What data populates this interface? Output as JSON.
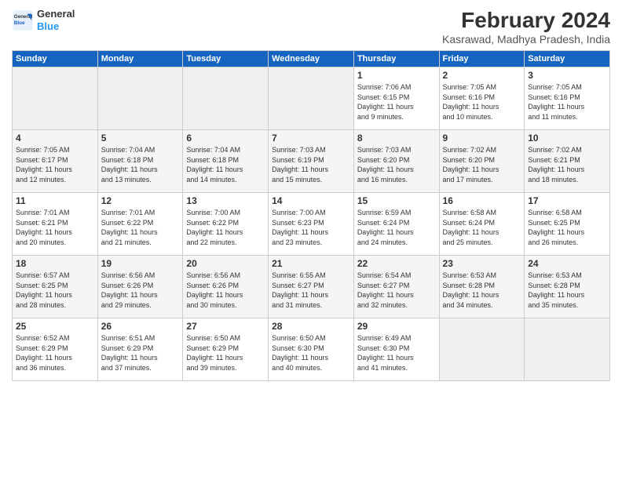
{
  "logo": {
    "line1": "General",
    "line2": "Blue"
  },
  "title": "February 2024",
  "subtitle": "Kasrawad, Madhya Pradesh, India",
  "headers": [
    "Sunday",
    "Monday",
    "Tuesday",
    "Wednesday",
    "Thursday",
    "Friday",
    "Saturday"
  ],
  "weeks": [
    [
      {
        "day": "",
        "info": ""
      },
      {
        "day": "",
        "info": ""
      },
      {
        "day": "",
        "info": ""
      },
      {
        "day": "",
        "info": ""
      },
      {
        "day": "1",
        "info": "Sunrise: 7:06 AM\nSunset: 6:15 PM\nDaylight: 11 hours\nand 9 minutes."
      },
      {
        "day": "2",
        "info": "Sunrise: 7:05 AM\nSunset: 6:16 PM\nDaylight: 11 hours\nand 10 minutes."
      },
      {
        "day": "3",
        "info": "Sunrise: 7:05 AM\nSunset: 6:16 PM\nDaylight: 11 hours\nand 11 minutes."
      }
    ],
    [
      {
        "day": "4",
        "info": "Sunrise: 7:05 AM\nSunset: 6:17 PM\nDaylight: 11 hours\nand 12 minutes."
      },
      {
        "day": "5",
        "info": "Sunrise: 7:04 AM\nSunset: 6:18 PM\nDaylight: 11 hours\nand 13 minutes."
      },
      {
        "day": "6",
        "info": "Sunrise: 7:04 AM\nSunset: 6:18 PM\nDaylight: 11 hours\nand 14 minutes."
      },
      {
        "day": "7",
        "info": "Sunrise: 7:03 AM\nSunset: 6:19 PM\nDaylight: 11 hours\nand 15 minutes."
      },
      {
        "day": "8",
        "info": "Sunrise: 7:03 AM\nSunset: 6:20 PM\nDaylight: 11 hours\nand 16 minutes."
      },
      {
        "day": "9",
        "info": "Sunrise: 7:02 AM\nSunset: 6:20 PM\nDaylight: 11 hours\nand 17 minutes."
      },
      {
        "day": "10",
        "info": "Sunrise: 7:02 AM\nSunset: 6:21 PM\nDaylight: 11 hours\nand 18 minutes."
      }
    ],
    [
      {
        "day": "11",
        "info": "Sunrise: 7:01 AM\nSunset: 6:21 PM\nDaylight: 11 hours\nand 20 minutes."
      },
      {
        "day": "12",
        "info": "Sunrise: 7:01 AM\nSunset: 6:22 PM\nDaylight: 11 hours\nand 21 minutes."
      },
      {
        "day": "13",
        "info": "Sunrise: 7:00 AM\nSunset: 6:22 PM\nDaylight: 11 hours\nand 22 minutes."
      },
      {
        "day": "14",
        "info": "Sunrise: 7:00 AM\nSunset: 6:23 PM\nDaylight: 11 hours\nand 23 minutes."
      },
      {
        "day": "15",
        "info": "Sunrise: 6:59 AM\nSunset: 6:24 PM\nDaylight: 11 hours\nand 24 minutes."
      },
      {
        "day": "16",
        "info": "Sunrise: 6:58 AM\nSunset: 6:24 PM\nDaylight: 11 hours\nand 25 minutes."
      },
      {
        "day": "17",
        "info": "Sunrise: 6:58 AM\nSunset: 6:25 PM\nDaylight: 11 hours\nand 26 minutes."
      }
    ],
    [
      {
        "day": "18",
        "info": "Sunrise: 6:57 AM\nSunset: 6:25 PM\nDaylight: 11 hours\nand 28 minutes."
      },
      {
        "day": "19",
        "info": "Sunrise: 6:56 AM\nSunset: 6:26 PM\nDaylight: 11 hours\nand 29 minutes."
      },
      {
        "day": "20",
        "info": "Sunrise: 6:56 AM\nSunset: 6:26 PM\nDaylight: 11 hours\nand 30 minutes."
      },
      {
        "day": "21",
        "info": "Sunrise: 6:55 AM\nSunset: 6:27 PM\nDaylight: 11 hours\nand 31 minutes."
      },
      {
        "day": "22",
        "info": "Sunrise: 6:54 AM\nSunset: 6:27 PM\nDaylight: 11 hours\nand 32 minutes."
      },
      {
        "day": "23",
        "info": "Sunrise: 6:53 AM\nSunset: 6:28 PM\nDaylight: 11 hours\nand 34 minutes."
      },
      {
        "day": "24",
        "info": "Sunrise: 6:53 AM\nSunset: 6:28 PM\nDaylight: 11 hours\nand 35 minutes."
      }
    ],
    [
      {
        "day": "25",
        "info": "Sunrise: 6:52 AM\nSunset: 6:29 PM\nDaylight: 11 hours\nand 36 minutes."
      },
      {
        "day": "26",
        "info": "Sunrise: 6:51 AM\nSunset: 6:29 PM\nDaylight: 11 hours\nand 37 minutes."
      },
      {
        "day": "27",
        "info": "Sunrise: 6:50 AM\nSunset: 6:29 PM\nDaylight: 11 hours\nand 39 minutes."
      },
      {
        "day": "28",
        "info": "Sunrise: 6:50 AM\nSunset: 6:30 PM\nDaylight: 11 hours\nand 40 minutes."
      },
      {
        "day": "29",
        "info": "Sunrise: 6:49 AM\nSunset: 6:30 PM\nDaylight: 11 hours\nand 41 minutes."
      },
      {
        "day": "",
        "info": ""
      },
      {
        "day": "",
        "info": ""
      }
    ]
  ]
}
